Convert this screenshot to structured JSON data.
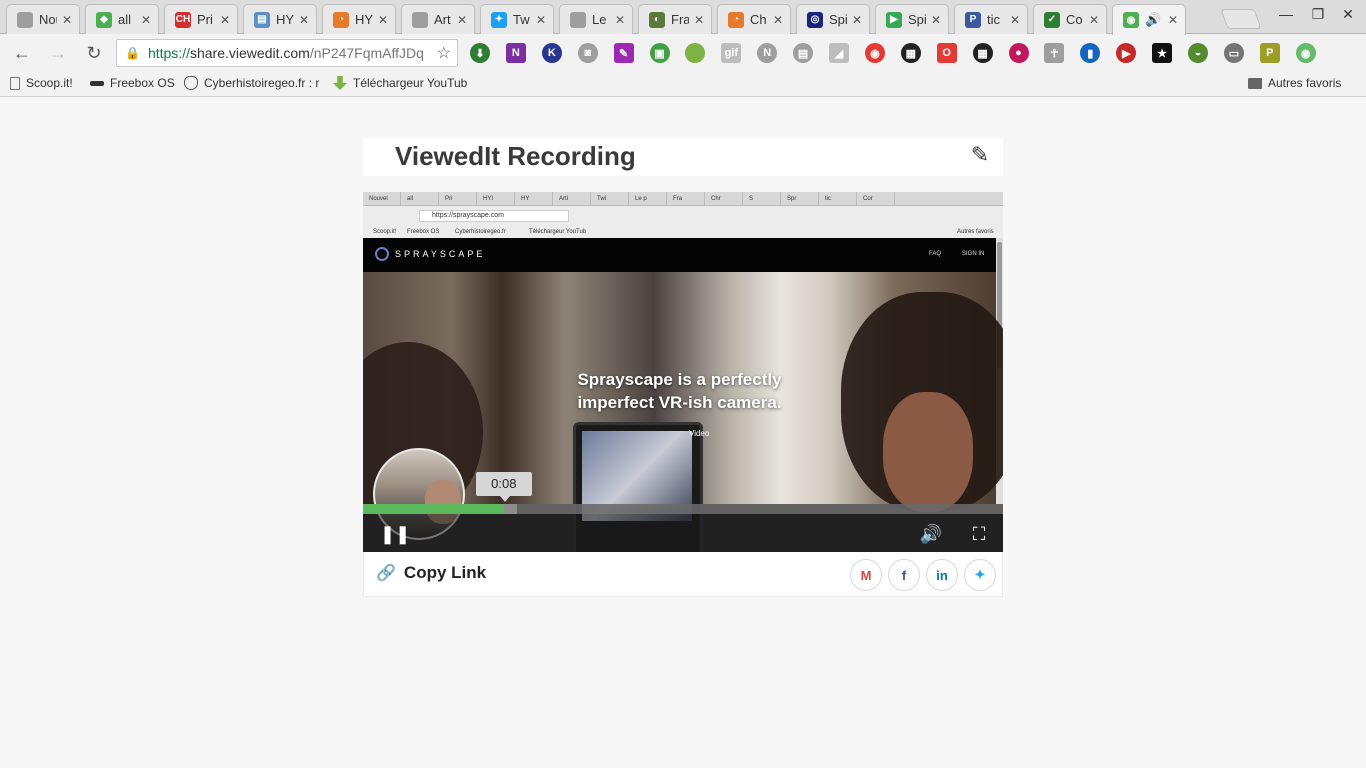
{
  "browser": {
    "tabs": [
      {
        "title": "Nouvel",
        "color": "#9e9e9e",
        "glyph": ""
      },
      {
        "title": "all",
        "color": "#4caf50",
        "glyph": "◆"
      },
      {
        "title": "Pri",
        "color": "#d32f2f",
        "glyph": "CH"
      },
      {
        "title": "HY",
        "color": "#5c8fc4",
        "glyph": "▤"
      },
      {
        "title": "HY",
        "color": "#e57b2a",
        "glyph": "◔"
      },
      {
        "title": "Art",
        "color": "#9e9e9e",
        "glyph": ""
      },
      {
        "title": "Tw",
        "color": "#1da1f2",
        "glyph": "✦"
      },
      {
        "title": "Le",
        "color": "#9e9e9e",
        "glyph": ""
      },
      {
        "title": "Fra",
        "color": "#5e7a3a",
        "glyph": "◐"
      },
      {
        "title": "Ch",
        "color": "#e57b2a",
        "glyph": "◔"
      },
      {
        "title": "Spi",
        "color": "#1a237e",
        "glyph": "◎"
      },
      {
        "title": "Spi",
        "color": "#34a853",
        "glyph": "▶"
      },
      {
        "title": "tic",
        "color": "#3b5998",
        "glyph": "P"
      },
      {
        "title": "Co",
        "color": "#2e7d32",
        "glyph": "✓"
      },
      {
        "title": "🔊",
        "color": "#4caf50",
        "glyph": "◉"
      }
    ],
    "tab_close_glyph": "✕",
    "window": {
      "minimize": "—",
      "restore": "❐",
      "close": "✕"
    },
    "nav": {
      "back": "←",
      "forward": "→",
      "reload": "↻"
    },
    "address": {
      "lock": "🔒",
      "scheme": "https://",
      "host": "share.viewedit.com",
      "path": "/nP247FqmAffJDq",
      "star": "☆"
    },
    "extensions": [
      {
        "name": "download-ext-icon",
        "color": "#2e7d32",
        "glyph": "⬇"
      },
      {
        "name": "onenote-icon",
        "color": "#7b2fa1",
        "glyph": "N"
      },
      {
        "name": "k-ext-icon",
        "color": "#283593",
        "glyph": "K"
      },
      {
        "name": "camera-icon",
        "color": "#9e9e9e",
        "glyph": "◙"
      },
      {
        "name": "feather-icon",
        "color": "#9c27b0",
        "glyph": "✎"
      },
      {
        "name": "print-ext-icon",
        "color": "#43a047",
        "glyph": "▣"
      },
      {
        "name": "green-dot-icon",
        "color": "#7cb342",
        "glyph": ""
      },
      {
        "name": "gif-ext-icon",
        "color": "#bdbdbd",
        "glyph": "gif"
      },
      {
        "name": "n-ext-icon",
        "color": "#9e9e9e",
        "glyph": "N"
      },
      {
        "name": "stack-ext-icon",
        "color": "#9e9e9e",
        "glyph": "▤"
      },
      {
        "name": "rss-icon",
        "color": "#bdbdbd",
        "glyph": "◢"
      },
      {
        "name": "broadcast-icon",
        "color": "#e53935",
        "glyph": "◉"
      },
      {
        "name": "qr-code-icon",
        "color": "#212121",
        "glyph": "▦"
      },
      {
        "name": "opera-icon",
        "color": "#e53935",
        "glyph": "O"
      },
      {
        "name": "qr-code-2-icon",
        "color": "#212121",
        "glyph": "▦"
      },
      {
        "name": "pink-circle-icon",
        "color": "#c2185b",
        "glyph": "●"
      },
      {
        "name": "ankh-icon",
        "color": "#9e9e9e",
        "glyph": "☥"
      },
      {
        "name": "book-ext-icon",
        "color": "#1565c0",
        "glyph": "▮"
      },
      {
        "name": "red-ext-icon",
        "color": "#c62828",
        "glyph": "▶"
      },
      {
        "name": "star-ext-icon",
        "color": "#111111",
        "glyph": "★"
      },
      {
        "name": "turtle-icon",
        "color": "#558b2f",
        "glyph": "◒"
      },
      {
        "name": "cast-icon",
        "color": "#757575",
        "glyph": "▭"
      },
      {
        "name": "pdf-ext-icon",
        "color": "#9e9d24",
        "glyph": "P"
      },
      {
        "name": "viewedit-ext-icon",
        "color": "#66bb6a",
        "glyph": "◉"
      }
    ],
    "bookmarks": [
      {
        "label": "Scoop.it!",
        "icon": "page-icon"
      },
      {
        "label": "Freebox OS",
        "icon": "freebox-icon"
      },
      {
        "label": "Cyberhistoiregeo.fr : r",
        "icon": "wolf-icon"
      },
      {
        "label": "Téléchargeur YouTub",
        "icon": "download-arrow-icon"
      }
    ],
    "other_bookmarks": "Autres favoris"
  },
  "page": {
    "title": "ViewedIt Recording",
    "edit_glyph": "✎",
    "player": {
      "current_time": "0:08",
      "progress_fraction": 0.22,
      "buffered_fraction": 0.24,
      "pause_glyph": "❚❚",
      "volume_glyph": "🔊",
      "fullscreen_glyph": "⛶",
      "recorded": {
        "tabs": [
          "Nouvel",
          "all",
          "Pri",
          "HYI",
          "HY",
          "Arti",
          "Twi",
          "Le p",
          "Fra",
          "Chr",
          "S",
          "Spr",
          "tic",
          "Cor"
        ],
        "url": "https://sprayscape.com",
        "bookmarks": [
          "Scoop.it!",
          "Freebox OS",
          "Cyberhistoiregeo.fr",
          "Téléchargeur YouTub"
        ],
        "other_bookmarks": "Autres favoris",
        "site_name": "SPRAYSCAPE",
        "nav": [
          "FAQ",
          "SIGN IN"
        ],
        "headline_line1": "Sprayscape is a perfectly",
        "headline_line2": "imperfect VR-ish camera.",
        "video_link": "Video"
      }
    },
    "footer": {
      "copy_link": "Copy Link",
      "link_glyph": "🔗",
      "share": [
        {
          "name": "gmail-share-icon",
          "glyph": "M",
          "color": "#d44638"
        },
        {
          "name": "facebook-share-icon",
          "glyph": "f",
          "color": "#3b5998"
        },
        {
          "name": "linkedin-share-icon",
          "glyph": "in",
          "color": "#0077b5"
        },
        {
          "name": "twitter-share-icon",
          "glyph": "✦",
          "color": "#1da1f2"
        }
      ]
    }
  }
}
